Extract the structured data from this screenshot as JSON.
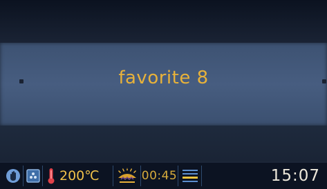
{
  "program": {
    "title": "favorite 8"
  },
  "status_bar": {
    "mode_icon": "hand-icon",
    "fan_icon": "fan-icon",
    "temperature_icon": "thermometer-icon",
    "temperature": "200℃",
    "heating_icon": "heating-element-icon",
    "timer": "00:45",
    "level_icon": "shelf-level-icon",
    "clock": "15:07"
  },
  "colors": {
    "accent": "#e8b23a",
    "thermometer": "#e0424a",
    "band": "#475d80",
    "icon_blue": "#5c8ecf"
  }
}
